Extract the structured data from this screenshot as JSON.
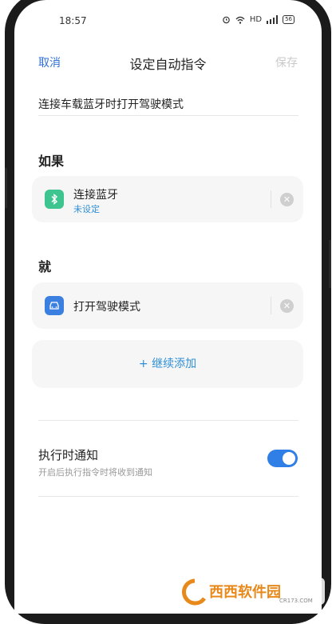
{
  "status_bar": {
    "time": "18:57",
    "network": "HD",
    "battery": "56"
  },
  "header": {
    "cancel_label": "取消",
    "title": "设定自动指令",
    "save_label": "保存"
  },
  "command_name": {
    "value": "连接车载蓝牙时打开驾驶模式"
  },
  "if_section": {
    "title": "如果",
    "condition": {
      "icon": "bluetooth-icon",
      "label": "连接蓝牙",
      "sublabel": "未设定",
      "color": "#3ec48f"
    }
  },
  "then_section": {
    "title": "就",
    "action": {
      "icon": "car-icon",
      "label": "打开驾驶模式",
      "color": "#3b7fe0"
    },
    "add_label": "+ 继续添加"
  },
  "notify": {
    "title": "执行时通知",
    "subtitle": "开启后执行指令时将收到通知",
    "enabled": true
  },
  "watermark": {
    "text": "西西软件园",
    "subtext": "CR173.COM"
  },
  "colors": {
    "accent": "#2f6fdc",
    "toggle_on": "#2f7fe6"
  }
}
